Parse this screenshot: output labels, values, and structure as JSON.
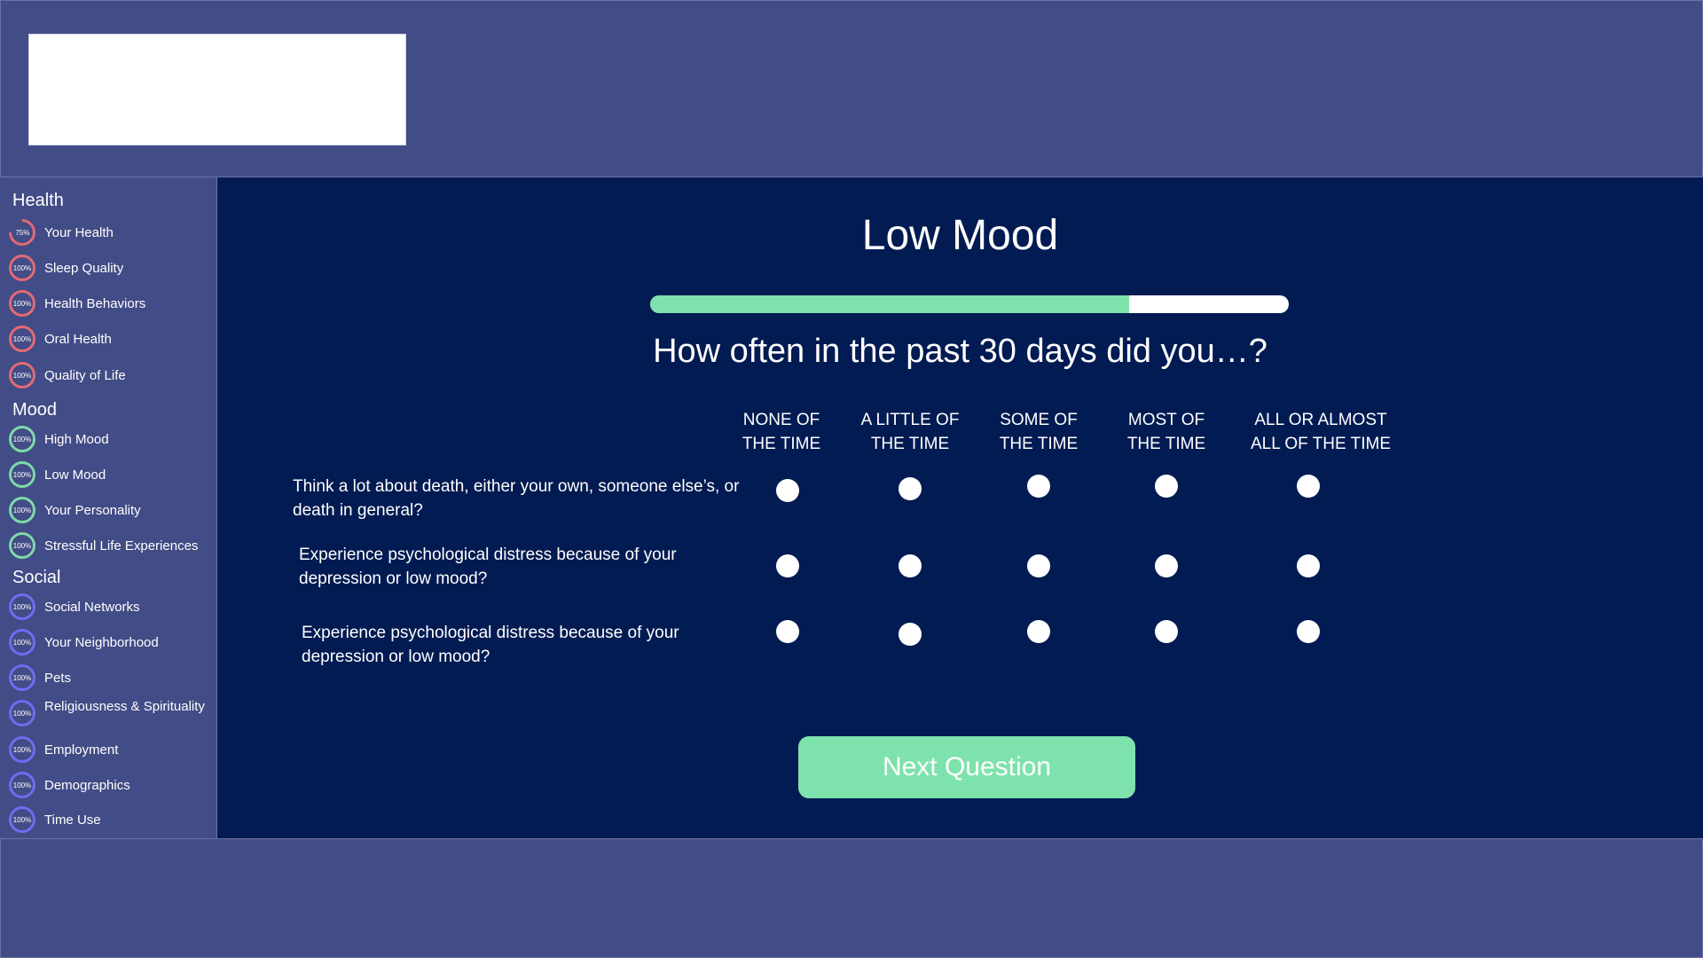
{
  "sidebar": {
    "sections": [
      {
        "title": "Health",
        "items": [
          {
            "label": "Your Health",
            "percent": "75%"
          },
          {
            "label": "Sleep Quality",
            "percent": "100%"
          },
          {
            "label": "Health Behaviors",
            "percent": "100%"
          },
          {
            "label": "Oral Health",
            "percent": "100%"
          },
          {
            "label": "Quality of Life",
            "percent": "100%"
          }
        ]
      },
      {
        "title": "Mood",
        "items": [
          {
            "label": "High Mood",
            "percent": "100%"
          },
          {
            "label": "Low Mood",
            "percent": "100%"
          },
          {
            "label": "Your Personality",
            "percent": "100%"
          },
          {
            "label": "Stressful Life Experiences",
            "percent": "100%"
          }
        ]
      },
      {
        "title": "Social",
        "items": [
          {
            "label": "Social Networks",
            "percent": "100%"
          },
          {
            "label": "Your Neighborhood",
            "percent": "100%"
          },
          {
            "label": "Pets",
            "percent": "100%"
          },
          {
            "label": "Religiousness & Spirituality",
            "percent": "100%"
          },
          {
            "label": "Employment",
            "percent": "100%"
          },
          {
            "label": "Demographics",
            "percent": "100%"
          },
          {
            "label": "Time Use",
            "percent": "100%"
          }
        ]
      }
    ]
  },
  "main": {
    "title": "Low Mood",
    "progress": 0.75,
    "prompt": "How often in the past 30 days did you…?",
    "columns": [
      "NONE OF\nTHE TIME",
      "A LITTLE OF\nTHE TIME",
      "SOME OF\nTHE TIME",
      "MOST OF\nTHE TIME",
      "ALL OR ALMOST\nALL OF THE TIME"
    ],
    "questions": [
      "Think a lot about death, either your own, someone else’s, or death in general?",
      "Experience psychological distress because of your depression or low mood?",
      "Experience psychological distress because of your depression or low mood?"
    ],
    "next_label": "Next Question"
  },
  "colors": {
    "page_bg": "#424c86",
    "main_bg": "#021b52",
    "accent_green": "#7ee2ac",
    "health_ring": "#e36a74",
    "mood_ring": "#7ed9a8",
    "social_ring": "#6f6cf0"
  }
}
